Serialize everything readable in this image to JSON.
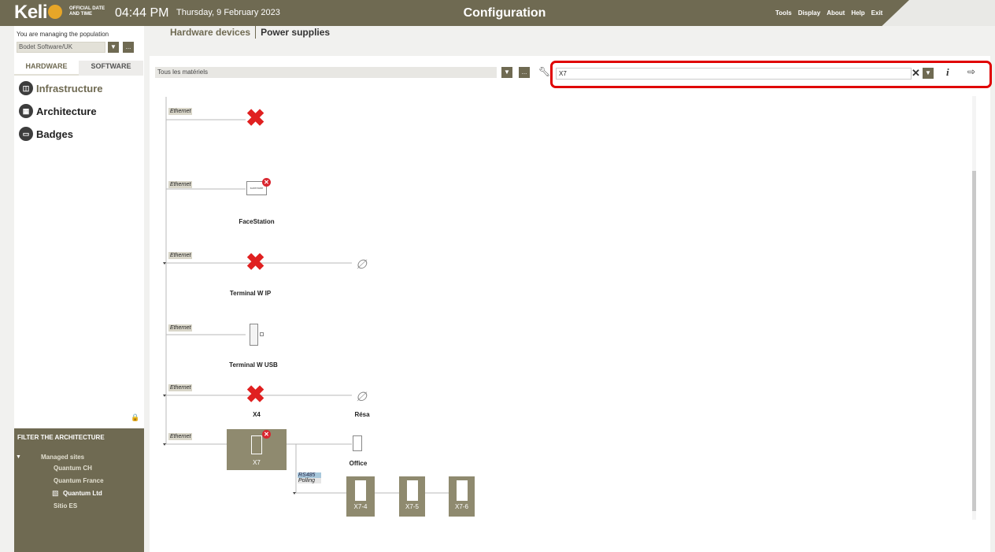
{
  "header": {
    "logo": "Keli",
    "tagline": "OFFICIAL DATE AND TIME",
    "time": "04:44 PM",
    "date": "Thursday, 9 February 2023",
    "title": "Configuration",
    "menu": [
      "Tools",
      "Display",
      "About",
      "Help",
      "Exit"
    ]
  },
  "sidebar": {
    "population_label": "You are managing the population",
    "population_value": "Bodet Software/UK",
    "more_label": "...",
    "tabs": [
      "HARDWARE",
      "SOFTWARE"
    ],
    "nav": [
      {
        "label": "Infrastructure",
        "icon": "infrastructure-icon"
      },
      {
        "label": "Architecture",
        "icon": "architecture-icon"
      },
      {
        "label": "Badges",
        "icon": "badges-icon"
      }
    ],
    "filter": {
      "title": "FILTER THE ARCHITECTURE",
      "root": "Managed sites",
      "sites": [
        "Quantum CH",
        "Quantum France",
        "Quantum Ltd",
        "Sitio ES"
      ]
    }
  },
  "main": {
    "tabs": [
      "Hardware devices",
      "Power supplies"
    ],
    "material_filter": "Tous les matériels",
    "more_label": "...",
    "search_value": "X7"
  },
  "diagram": {
    "ethernet_label": "Ethernet",
    "rs485_label": "RS485",
    "polling_label": "Polling",
    "screen_text": "suremote",
    "devices": [
      "FaceStation",
      "Terminal W IP",
      "Terminal W USB",
      "X4",
      "Résa",
      "X7",
      "Office",
      "X7-4",
      "X7-5",
      "X7-6"
    ]
  },
  "colors": {
    "header_bg": "#6f6a52",
    "logo_dot": "#e7a628",
    "highlight_border": "#e00000",
    "error_red": "#d9262f"
  }
}
